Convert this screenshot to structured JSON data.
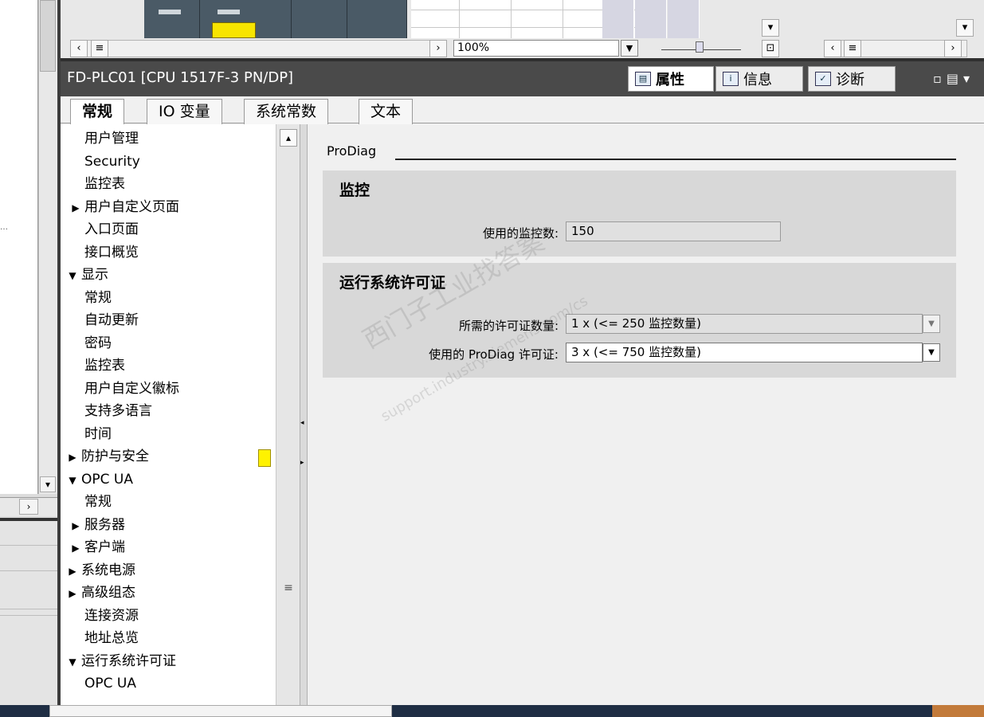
{
  "toolbar": {
    "zoom_value": "100%"
  },
  "header": {
    "title": "FD-PLC01 [CPU 1517F-3 PN/DP]",
    "tabs": [
      {
        "label": "属性",
        "icon": "properties-icon"
      },
      {
        "label": "信息",
        "icon": "info-icon"
      },
      {
        "label": "诊断",
        "icon": "diagnostics-icon"
      }
    ]
  },
  "subtabs": [
    "常规",
    "IO 变量",
    "系统常数",
    "文本"
  ],
  "nav": {
    "items": [
      {
        "label": "用户管理",
        "level": 2,
        "arrow": ""
      },
      {
        "label": "Security",
        "level": 2,
        "arrow": ""
      },
      {
        "label": "监控表",
        "level": 2,
        "arrow": ""
      },
      {
        "label": "用户自定义页面",
        "level": 1,
        "arrow": "▶"
      },
      {
        "label": "入口页面",
        "level": 2,
        "arrow": ""
      },
      {
        "label": "接口概览",
        "level": 2,
        "arrow": ""
      },
      {
        "label": "显示",
        "level": 0,
        "arrow": "▼"
      },
      {
        "label": "常规",
        "level": 2,
        "arrow": ""
      },
      {
        "label": "自动更新",
        "level": 2,
        "arrow": ""
      },
      {
        "label": "密码",
        "level": 2,
        "arrow": ""
      },
      {
        "label": "监控表",
        "level": 2,
        "arrow": ""
      },
      {
        "label": "用户自定义徽标",
        "level": 2,
        "arrow": ""
      },
      {
        "label": "支持多语言",
        "level": 1,
        "arrow": ""
      },
      {
        "label": "时间",
        "level": 1,
        "arrow": ""
      },
      {
        "label": "防护与安全",
        "level": 0,
        "arrow": "▶"
      },
      {
        "label": "OPC UA",
        "level": 0,
        "arrow": "▼"
      },
      {
        "label": "常规",
        "level": 2,
        "arrow": ""
      },
      {
        "label": "服务器",
        "level": 1,
        "arrow": "▶"
      },
      {
        "label": "客户端",
        "level": 1,
        "arrow": "▶"
      },
      {
        "label": "系统电源",
        "level": 0,
        "arrow": "▶"
      },
      {
        "label": "高级组态",
        "level": 0,
        "arrow": "▶"
      },
      {
        "label": "连接资源",
        "level": 1,
        "arrow": ""
      },
      {
        "label": "地址总览",
        "level": 1,
        "arrow": ""
      },
      {
        "label": "运行系统许可证",
        "level": 0,
        "arrow": "▼"
      },
      {
        "label": "OPC UA",
        "level": 2,
        "arrow": ""
      }
    ]
  },
  "content": {
    "section_title": "ProDiag",
    "monitoring": {
      "title": "监控",
      "used_label": "使用的监控数:",
      "used_value": "150"
    },
    "license": {
      "title": "运行系统许可证",
      "required_label": "所需的许可证数量:",
      "required_value": "1 x (<= 250 监控数量)",
      "used_label": "使用的 ProDiag 许可证:",
      "used_value": "3 x (<= 750 监控数量)"
    }
  },
  "watermark": {
    "line1": "西门子工业找答案",
    "line2": "support.industry.siemens.com/cs"
  }
}
